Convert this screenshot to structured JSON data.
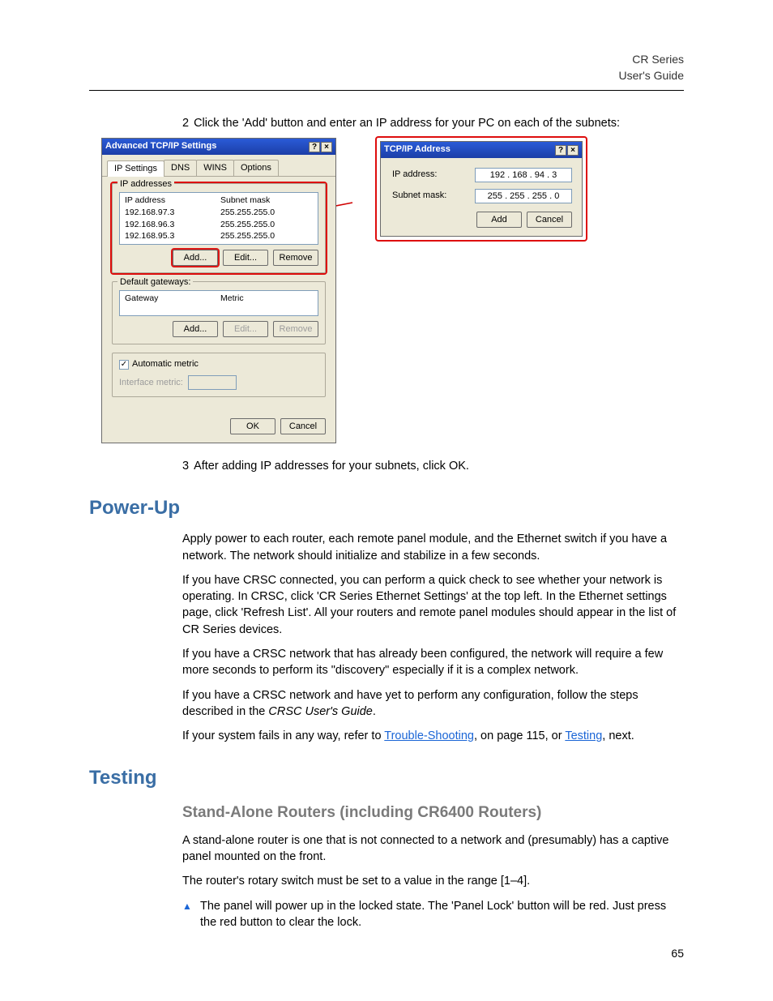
{
  "header": {
    "line1": "CR Series",
    "line2": "User's Guide"
  },
  "step2": {
    "num": "2",
    "text": "Click the 'Add' button and enter an IP address for your PC on each of the subnets:"
  },
  "dialog1": {
    "title": "Advanced TCP/IP Settings",
    "tabs": [
      "IP Settings",
      "DNS",
      "WINS",
      "Options"
    ],
    "group_ip": {
      "title": "IP addresses",
      "col1": "IP address",
      "col2": "Subnet mask",
      "rows": [
        {
          "ip": "192.168.97.3",
          "mask": "255.255.255.0"
        },
        {
          "ip": "192.168.96.3",
          "mask": "255.255.255.0"
        },
        {
          "ip": "192.168.95.3",
          "mask": "255.255.255.0"
        }
      ],
      "btn_add": "Add...",
      "btn_edit": "Edit...",
      "btn_remove": "Remove"
    },
    "group_gw": {
      "title": "Default gateways:",
      "col1": "Gateway",
      "col2": "Metric",
      "btn_add": "Add...",
      "btn_edit": "Edit...",
      "btn_remove": "Remove"
    },
    "auto_metric": "Automatic metric",
    "interface_metric": "Interface metric:",
    "btn_ok": "OK",
    "btn_cancel": "Cancel"
  },
  "dialog2": {
    "title": "TCP/IP Address",
    "lbl_ip": "IP address:",
    "val_ip": "192 . 168 .  94 .   3",
    "lbl_mask": "Subnet mask:",
    "val_mask": "255 . 255 . 255 .   0",
    "btn_add": "Add",
    "btn_cancel": "Cancel"
  },
  "step3": {
    "num": "3",
    "text": "After adding IP addresses for your subnets, click OK."
  },
  "powerup": {
    "heading": "Power-Up",
    "p1": "Apply power to each router, each remote panel module, and the Ethernet switch if you have a network. The network should initialize and stabilize in a few seconds.",
    "p2": "If you have CRSC connected, you can perform a quick check to see whether your network is operating. In CRSC, click 'CR Series Ethernet Settings' at the top left. In the Ethernet settings page, click 'Refresh List'. All your routers and remote panel modules should appear in the list of CR Series devices.",
    "p3": "If you have a CRSC network that has already been configured, the network will require a few more seconds to perform its \"discovery\" especially if it is a complex network.",
    "p4_a": "If you have a CRSC network and have yet to perform any configuration, follow the steps described in the ",
    "p4_b": "CRSC User's Guide",
    "p4_c": ".",
    "p5_a": "If your system fails in any way, refer to ",
    "p5_link1": "Trouble-Shooting",
    "p5_b": ", on page 115, or ",
    "p5_link2": "Testing",
    "p5_c": ", next."
  },
  "testing": {
    "heading": "Testing",
    "sub": "Stand-Alone Routers (including CR6400 Routers)",
    "p1": "A stand-alone router is one that is not connected to a network and (presumably) has a captive panel mounted on the front.",
    "p2": "The router's rotary switch must be set to a value in the range [1–4].",
    "bullet": "The panel will power up in the locked state. The 'Panel Lock' button will be red. Just press the red button to clear the lock."
  },
  "pagenum": "65"
}
